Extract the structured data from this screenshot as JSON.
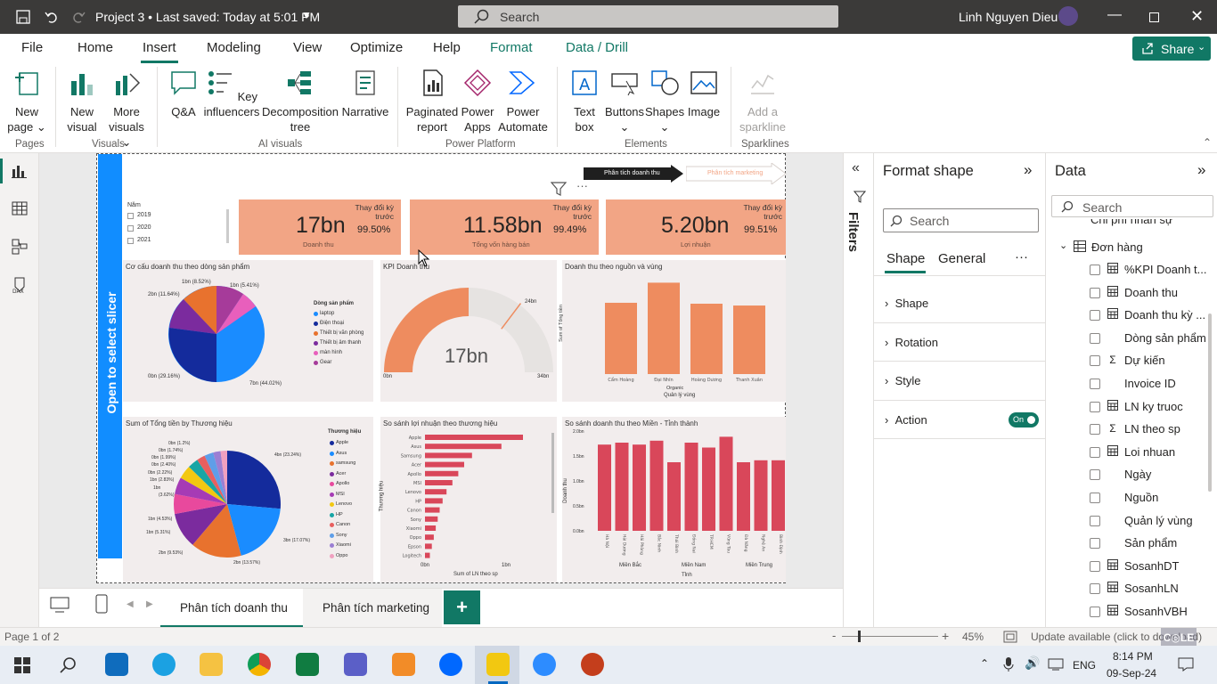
{
  "titlebar": {
    "title": "Project 3 • Last saved: Today at 5:01 PM",
    "search_placeholder": "Search",
    "user": "Linh Nguyen Dieu"
  },
  "tabs": [
    {
      "label": "File"
    },
    {
      "label": "Home"
    },
    {
      "label": "Insert"
    },
    {
      "label": "Modeling"
    },
    {
      "label": "View"
    },
    {
      "label": "Optimize"
    },
    {
      "label": "Help"
    },
    {
      "label": "Format"
    },
    {
      "label": "Data / Drill"
    }
  ],
  "share_label": "Share",
  "ribbon": {
    "new_page": "New page",
    "new_visual": "New visual",
    "more_visuals": "More visuals",
    "qa": "Q&A",
    "key_influencers": "Key influencers",
    "decomposition_tree": "Decomposition tree",
    "narrative": "Narrative",
    "paginated_report": "Paginated report",
    "power_apps": "Power Apps",
    "power_automate": "Power Automate",
    "text_box": "Text box",
    "buttons": "Buttons",
    "shapes": "Shapes",
    "image": "Image",
    "add_sparkline": "Add a sparkline",
    "groups": {
      "pages": "Pages",
      "visuals": "Visuals",
      "ai_visuals": "AI visuals",
      "power_platform": "Power Platform",
      "elements": "Elements",
      "sparklines": "Sparklines"
    }
  },
  "report": {
    "slicer_label": "Open to select slicer",
    "nav_active": "Phân tích doanh thu",
    "nav_other": "Phân tích marketing",
    "year_title": "Năm",
    "years": [
      "2019",
      "2020",
      "2021"
    ],
    "kpis": [
      {
        "value": "17bn",
        "caption": "Doanh thu",
        "change_label": "Thay đổi kỳ trước",
        "pct": "99.50%"
      },
      {
        "value": "11.58bn",
        "caption": "Tổng vốn hàng bán",
        "change_label": "Thay đổi kỳ trước",
        "pct": "99.49%"
      },
      {
        "value": "5.20bn",
        "caption": "Lợi nhuận",
        "change_label": "Thay đổi kỳ trước",
        "pct": "99.51%"
      }
    ],
    "tiles": {
      "pie1_title": "Cơ cấu doanh thu theo dòng sản phẩm",
      "gauge_title": "KPI Doanh thu",
      "bar1_title": "Doanh thu theo nguồn và vùng",
      "pie2_title": "Sum of Tổng tiền by Thương hiệu",
      "hbar_title": "So sánh lợi nhuận theo thương hiệu",
      "bar2_title": "So sánh doanh thu theo Miền - Tỉnh thành"
    },
    "pie1_legend_title": "Dòng sản phẩm",
    "pie1_legend": [
      "laptop",
      "Điện thoại",
      "Thiết bị văn phòng",
      "Thiết bị âm thanh",
      "màn hình",
      "Gear"
    ],
    "pie1_labels": [
      "1bn (8.52%)",
      "1bn (5.41%)",
      "2bn (11.64%)",
      "0bn (29.16%)",
      "7bn (44.02%)"
    ],
    "gauge": {
      "value_label": "17bn",
      "min_label": "0bn",
      "max_label": "34bn",
      "target_label": "24bn",
      "value": 17,
      "min": 0,
      "max": 34,
      "target": 24
    },
    "bar1": {
      "ylabel": "Sum of Tổng tiền",
      "xlabel": "Quản lý vùng",
      "legend": "Organic",
      "categories": [
        "Cẩm Hoàng",
        "Đại Nhĩn",
        "Hoàng Dương",
        "Thanh Xuân"
      ],
      "values": [
        0.78,
        1.0,
        0.77,
        0.75
      ]
    },
    "pie2_legend_title": "Thương hiệu",
    "pie2_legend": [
      "Apple",
      "Asus",
      "samsung",
      "Acer",
      "Apollo",
      "MSI",
      "Lenovo",
      "HP",
      "Canon",
      "Sony",
      "Xiaomi",
      "Oppo"
    ],
    "pie2_labels": [
      "0bn (1.2%)",
      "0bn (1.74%)",
      "0bn (1.99%)",
      "0bn (2.40%)",
      "0bn (2.22%)",
      "1bn (2.83%)",
      "1bn",
      "(3.62%)",
      "1bn (4.53%)",
      "1bn (5.31%)",
      "2bn (9.53%)",
      "2bn (13.57%)",
      "3bn (17.07%)",
      "4bn (23.24%)"
    ],
    "hbar": {
      "ylabel": "Thương hiệu",
      "xlabel": "Sum of LN theo sp",
      "tick0": "0bn",
      "tick1": "1bn",
      "brands": [
        "Apple",
        "Asus",
        "Samsung",
        "Acer",
        "Apollo",
        "MSI",
        "Lenovo",
        "HP",
        "Canon",
        "Sony",
        "Xiaomi",
        "Oppo",
        "Epson",
        "Logitech"
      ],
      "values": [
        1.0,
        0.78,
        0.48,
        0.4,
        0.34,
        0.28,
        0.22,
        0.18,
        0.15,
        0.13,
        0.11,
        0.09,
        0.07,
        0.05
      ]
    },
    "bar2": {
      "ylabel": "Doanh thu",
      "xlabel": "Tỉnh",
      "yticks": [
        "2.0bn",
        "1.5bn",
        "1.0bn",
        "0.5bn",
        "0.0bn"
      ],
      "groups": [
        "Miền Bắc",
        "Miền Nam",
        "Miền Trung"
      ],
      "categories": [
        "Hà Nội",
        "Hải Dương",
        "Hải Phòng",
        "Bắc Ninh",
        "Thái Bình",
        "Đồng Nai",
        "TP.HCM",
        "Vũng Tàu",
        "Đà Nẵng",
        "Nghệ An",
        "Bình Định"
      ],
      "values": [
        0.88,
        0.9,
        0.88,
        0.92,
        0.7,
        0.9,
        0.85,
        0.96,
        0.7,
        0.72,
        0.72
      ]
    }
  },
  "pagetabs": {
    "tab1": "Phân tích doanh thu",
    "tab2": "Phân tích marketing",
    "add": "+"
  },
  "filters_label": "Filters",
  "format_pane": {
    "title": "Format shape",
    "search_placeholder": "Search",
    "tab_shape": "Shape",
    "tab_general": "General",
    "more": "···",
    "sections": [
      "Shape",
      "Rotation",
      "Style",
      "Action"
    ],
    "toggle_label": "On"
  },
  "data_pane": {
    "title": "Data",
    "search_placeholder": "Search",
    "partial_top": "Chi phí nhân sự",
    "table_name": "Đơn hàng",
    "fields": [
      {
        "label": "%KPI Doanh t...",
        "icon": "calc-icon"
      },
      {
        "label": "Doanh thu",
        "icon": "calc-icon"
      },
      {
        "label": "Doanh thu kỳ ...",
        "icon": "calc-icon"
      },
      {
        "label": "Dòng sản phẩm",
        "icon": ""
      },
      {
        "label": "Dự kiến",
        "icon": "sigma-icon"
      },
      {
        "label": "Invoice ID",
        "icon": ""
      },
      {
        "label": "LN ky truoc",
        "icon": "calc-icon"
      },
      {
        "label": "LN theo sp",
        "icon": "sigma-icon"
      },
      {
        "label": "Loi nhuan",
        "icon": "calc-icon"
      },
      {
        "label": "Ngày",
        "icon": ""
      },
      {
        "label": "Nguồn",
        "icon": ""
      },
      {
        "label": "Quản lý vùng",
        "icon": ""
      },
      {
        "label": "Sản phẩm",
        "icon": ""
      },
      {
        "label": "SosanhDT",
        "icon": "calc-icon"
      },
      {
        "label": "SosanhLN",
        "icon": "calc-icon"
      },
      {
        "label": "SosanhVBH",
        "icon": "calc-icon"
      }
    ]
  },
  "statusbar": {
    "page": "Page 1 of 2",
    "zoom": "45%",
    "update": "Update available (click to download)"
  },
  "taskbar": {
    "lang": "ENG",
    "time": "8:14 PM",
    "date": "09-Sep-24"
  },
  "colors": {
    "accent": "#f2a585",
    "bar1": "#ee8c5f",
    "red": "#d9475a",
    "slicer": "#118dff",
    "share": "#117865"
  }
}
